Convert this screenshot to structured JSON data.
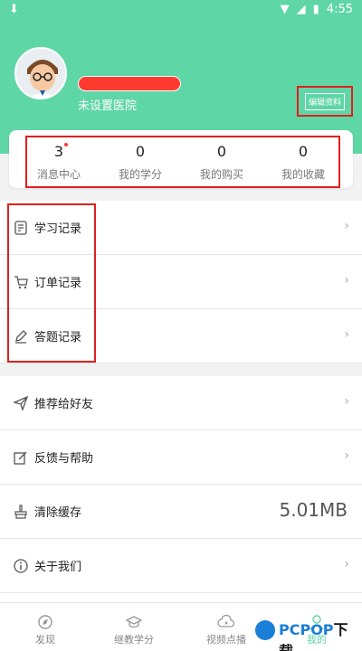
{
  "statusbar": {
    "time": "4:55"
  },
  "profile": {
    "hospital": "未设置医院",
    "edit_label": "编辑资料"
  },
  "stats": [
    {
      "value": "3",
      "label": "消息中心",
      "dot": true
    },
    {
      "value": "0",
      "label": "我的学分"
    },
    {
      "value": "0",
      "label": "我的购买"
    },
    {
      "value": "0",
      "label": "我的收藏"
    }
  ],
  "records": [
    {
      "label": "学习记录",
      "icon": "note-icon"
    },
    {
      "label": "订单记录",
      "icon": "cart-icon"
    },
    {
      "label": "答题记录",
      "icon": "pencil-icon"
    }
  ],
  "settings": [
    {
      "label": "推荐给好友",
      "icon": "send-icon"
    },
    {
      "label": "反馈与帮助",
      "icon": "edit-icon"
    },
    {
      "label": "清除缓存",
      "icon": "broom-icon",
      "value": "5.01MB"
    },
    {
      "label": "关于我们",
      "icon": "info-icon"
    }
  ],
  "tabs": [
    {
      "label": "发现",
      "icon": "discover-icon"
    },
    {
      "label": "继教学分",
      "icon": "graduation-cap-icon"
    },
    {
      "label": "视频点播",
      "icon": "cloud-play-icon"
    },
    {
      "label": "我的",
      "icon": "person-icon",
      "active": true
    }
  ],
  "watermark": {
    "brand_prefix": "PCPOP",
    "brand_suffix": "下载"
  },
  "colors": {
    "accent": "#5fd6a6",
    "highlight": "#e0201e"
  }
}
